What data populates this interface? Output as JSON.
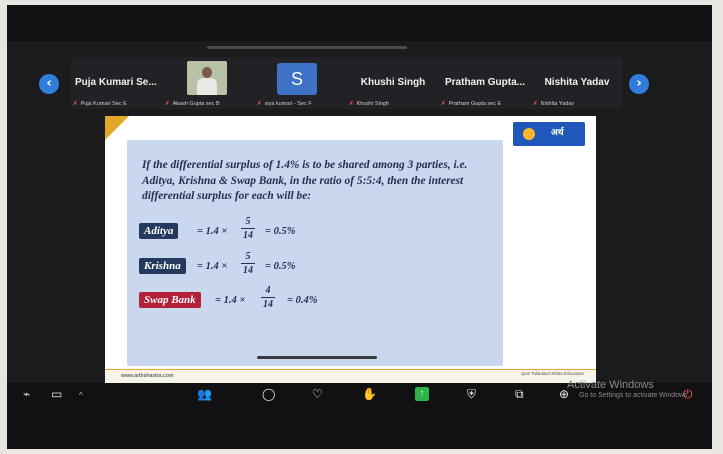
{
  "participants": [
    {
      "name": "Puja Kumari Se...",
      "sub": "Puja Kumari Sec E"
    },
    {
      "name": "",
      "sub": "Akash Gupta sec B"
    },
    {
      "name": "",
      "avatar": "S",
      "sub": "siya kumari - Sec F"
    },
    {
      "name": "Khushi Singh",
      "sub": "Khushi Singh"
    },
    {
      "name": "Pratham Gupta...",
      "sub": "Pratham Gupta sec E"
    },
    {
      "name": "Nishita Yadav",
      "sub": "Nishita Yadav"
    }
  ],
  "slide": {
    "logo": "अर्थ",
    "question": "If the differential surplus of 1.4% is to be shared among 3 parties, i.e. Aditya, Krishna & Swap Bank, in the ratio of 5:5:4, then the interest differential surplus for each will be:",
    "rows": [
      {
        "label": "Aditya",
        "color": "#233a5e",
        "pre": "= 1.4 ×",
        "num": "5",
        "den": "14",
        "post": "= 0.5%"
      },
      {
        "label": "Krishna",
        "color": "#233a5e",
        "pre": "= 1.4 ×",
        "num": "5",
        "den": "14",
        "post": "= 0.5%"
      },
      {
        "label": "Swap Bank",
        "color": "#b2203a",
        "pre": "= 1.4 ×",
        "num": "4",
        "den": "14",
        "post": "= 0.4%"
      }
    ],
    "website": "www.arthshastra.com",
    "credit": "Jyoti Tulsidas/Arthika Education"
  },
  "watermark": {
    "line1": "Activate Windows",
    "line2": "Go to Settings to activate Windows."
  },
  "toolbar": [
    "mic-icon",
    "video-icon",
    "participants-icon",
    "chat-icon",
    "react-icon",
    "raise-hand-icon",
    "share-icon",
    "security-icon",
    "apps-icon",
    "more-icon",
    "leave-icon"
  ],
  "colors": {
    "accent": "#2f7dd8",
    "panel": "#c9d7ef"
  }
}
